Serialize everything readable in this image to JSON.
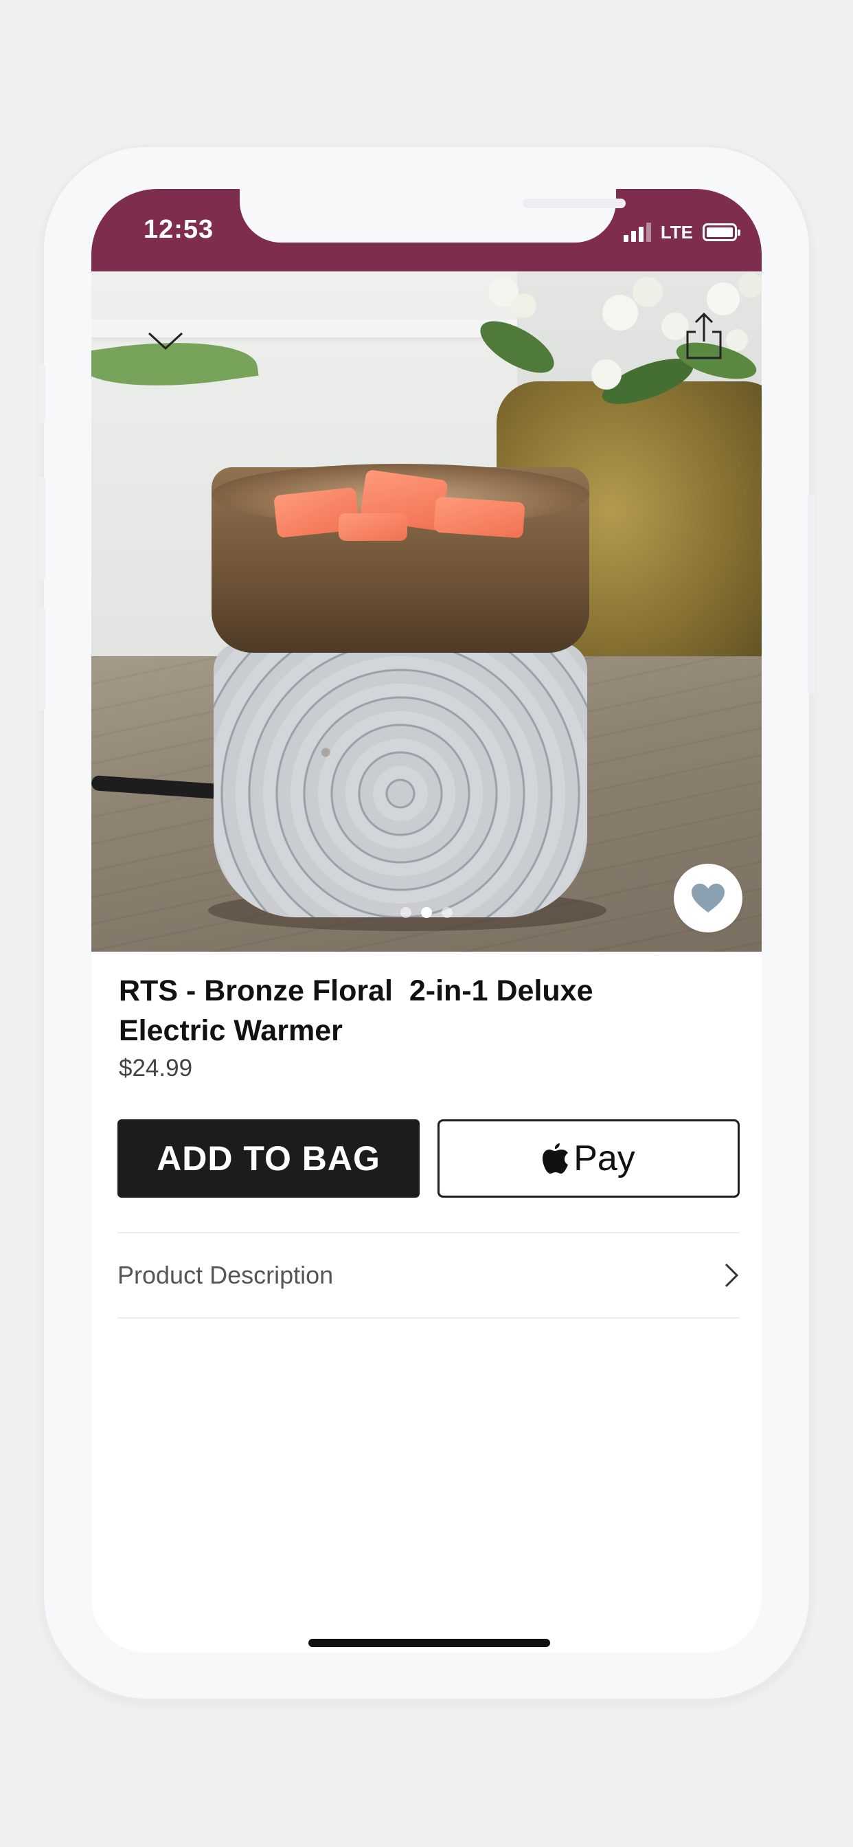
{
  "status_bar": {
    "time": "12:53",
    "network": "LTE",
    "signal_bars": 3,
    "battery_level": 0.85,
    "background": "#7f2d4f"
  },
  "hero": {
    "icons": {
      "collapse": "chevron-down-icon",
      "share": "share-icon",
      "favorite": "heart-icon"
    },
    "carousel_pages": 3,
    "carousel_active_index": 1
  },
  "product": {
    "title": "RTS - Bronze Floral  2-in-1 Deluxe\nElectric Warmer",
    "price": "$24.99"
  },
  "actions": {
    "add_to_bag": "ADD TO BAG",
    "apple_pay": "Pay"
  },
  "sections": {
    "description_label": "Product Description"
  },
  "colors": {
    "brand": "#7f2d4f",
    "button_dark": "#1c1c1c",
    "heart": "#8aa1b1"
  }
}
